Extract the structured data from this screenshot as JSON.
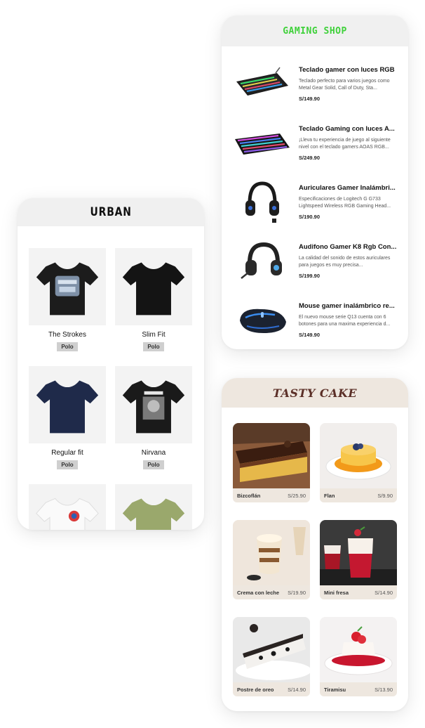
{
  "urban": {
    "title": "URBAN",
    "products": [
      {
        "name": "The Strokes",
        "badge": "Polo",
        "color": "#1c1c1c",
        "print": "graphic"
      },
      {
        "name": "Slim Fit",
        "badge": "Polo",
        "color": "#141414",
        "print": "none"
      },
      {
        "name": "Regular fit",
        "badge": "Polo",
        "color": "#1f2a4a",
        "print": "none"
      },
      {
        "name": "Nirvana",
        "badge": "Polo",
        "color": "#1a1a1a",
        "print": "photo"
      },
      {
        "name": "",
        "badge": "",
        "color": "#fafafa",
        "print": "logo"
      },
      {
        "name": "",
        "badge": "",
        "color": "#9aa86c",
        "print": "none"
      }
    ]
  },
  "gaming": {
    "title": "GAMING SHOP",
    "accent": "#3fd13a",
    "products": [
      {
        "title": "Teclado gamer con luces RGB",
        "desc": "Teclado perfecto para varios juegos como Metal Gear Solid, Call of Duty, Sta...",
        "price": "S/149.90",
        "icon": "keyboard-icon"
      },
      {
        "title": "Teclado Gaming con luces A...",
        "desc": "¡Lleva tu experiencia de juego al siguiente nivel con el teclado gamers AOAS RGB...",
        "price": "S/249.90",
        "icon": "keyboard-icon"
      },
      {
        "title": "Auriculares Gamer Inalámbri...",
        "desc": "Especificaciones de Logitech G G733 Lightspeed Wireless RGB Gaming Head...",
        "price": "S/190.90",
        "icon": "headset-icon"
      },
      {
        "title": "Audifono Gamer K8 Rgb Con...",
        "desc": "La calidad del sonido de estos auriculares para juegos es muy precisa...",
        "price": "S/199.90",
        "icon": "headset-icon"
      },
      {
        "title": "Mouse gamer inalámbrico re...",
        "desc": "El nuevo mouse serie Q13 cuenta con 6 botones para una maxima experiencia d...",
        "price": "S/149.90",
        "icon": "mouse-icon"
      }
    ]
  },
  "tasty": {
    "title": "TASTY CAKE",
    "accent": "#5b2f27",
    "products": [
      {
        "name": "Bizcoflán",
        "price": "S/25.90"
      },
      {
        "name": "Flan",
        "price": "S/9.90"
      },
      {
        "name": "Crema con leche",
        "price": "S/19.90"
      },
      {
        "name": "Mini fresa",
        "price": "S/14.90"
      },
      {
        "name": "Postre de oreo",
        "price": "S/14.90"
      },
      {
        "name": "Tiramisu",
        "price": "S/13.90"
      }
    ]
  }
}
